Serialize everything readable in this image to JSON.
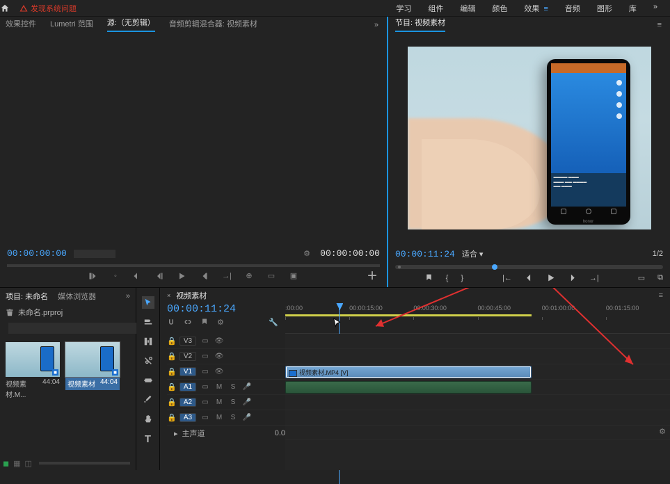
{
  "topbar": {
    "warning": "发现系统问题",
    "tabs": [
      "学习",
      "组件",
      "编辑",
      "颜色",
      "效果",
      "音频",
      "图形",
      "库"
    ],
    "active_tab": "效果"
  },
  "source_panel": {
    "tabs": [
      "效果控件",
      "Lumetri 范围",
      "源:（无剪辑）",
      "音频剪辑混合器: 视频素材"
    ],
    "active": "源:（无剪辑）",
    "tc_left": "00:00:00:00",
    "tc_right": "00:00:00:00"
  },
  "program_panel": {
    "title": "节目: 视频素材",
    "tc": "00:00:11:24",
    "fit": "适合",
    "page": "1/2",
    "phone_brand": "honor"
  },
  "project": {
    "tab_project": "项目: 未命名",
    "tab_browser": "媒体浏览器",
    "file": "未命名.prproj",
    "items": [
      {
        "name": "视频素材.M...",
        "dur": "44:04",
        "selected": false
      },
      {
        "name": "视频素材",
        "dur": "44:04",
        "selected": true
      }
    ]
  },
  "timeline": {
    "title": "视频素材",
    "tc": "00:00:11:24",
    "ticks": [
      ":00:00",
      "00:00:15:00",
      "00:00:30:00",
      "00:00:45:00",
      "00:01:00:00",
      "00:01:15:00"
    ],
    "playhead_pct": 14,
    "region_end_pct": 64,
    "tracks_v": [
      {
        "name": "V3",
        "on": false
      },
      {
        "name": "V2",
        "on": false
      },
      {
        "name": "V1",
        "on": true
      }
    ],
    "tracks_a": [
      {
        "name": "A1",
        "on": true,
        "attrs": [
          "M",
          "S"
        ]
      },
      {
        "name": "A2",
        "on": true,
        "attrs": [
          "M",
          "S"
        ]
      },
      {
        "name": "A3",
        "on": true,
        "attrs": [
          "M",
          "S"
        ]
      }
    ],
    "clip_video": {
      "label": "视频素材.MP4 [V]",
      "start": 0,
      "width": 64
    },
    "clip_audio": {
      "start": 0,
      "width": 64
    },
    "master": "主声道",
    "master_val": "0.0"
  }
}
